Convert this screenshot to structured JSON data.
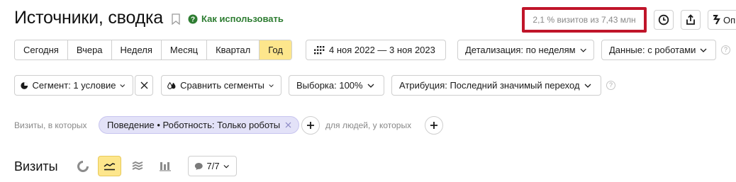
{
  "header": {
    "title": "Источники, сводка",
    "help_link": "Как использовать",
    "sample_info": "2,1 % визитов из 7,43 млн",
    "cut_button": "Оп"
  },
  "period": {
    "options": [
      "Сегодня",
      "Вчера",
      "Неделя",
      "Месяц",
      "Квартал",
      "Год"
    ],
    "active": "Год"
  },
  "date_range": "4 ноя 2022 — 3 ноя 2023",
  "detail": "Детализация: по неделям",
  "data_filter": "Данные: с роботами",
  "segment": "Сегмент: 1 условие",
  "compare": "Сравнить сегменты",
  "sample": "Выборка: 100%",
  "attribution": "Атрибуция: Последний значимый переход",
  "conditions": {
    "visits_label": "Визиты, в которых",
    "chip": "Поведение • Роботность: Только роботы",
    "people_label": "для людей, у которых"
  },
  "visits": {
    "title": "Визиты",
    "notes_count": "7/7"
  },
  "colors": {
    "accent_yellow": "#fde68c",
    "highlight_red": "#c0152a",
    "link_green": "#2e7d32",
    "chip_bg": "#e3e2f8"
  }
}
